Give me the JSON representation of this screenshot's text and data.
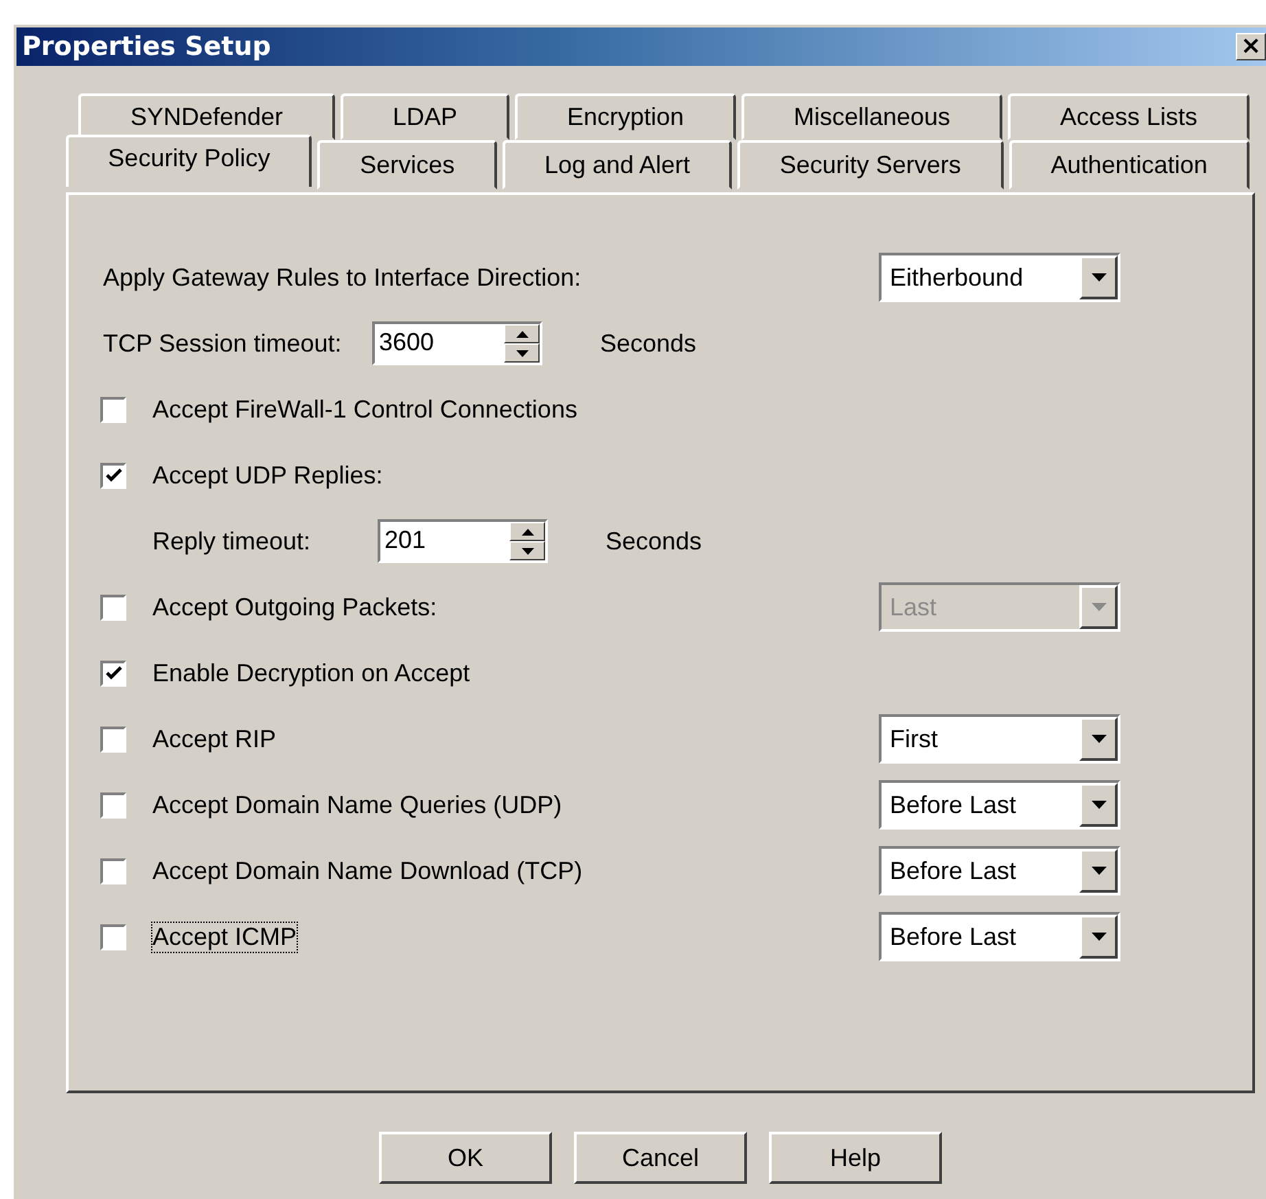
{
  "window": {
    "title": "Properties Setup",
    "close": "×"
  },
  "tab_rows": [
    [
      {
        "label": "SYNDefender",
        "selected": false
      },
      {
        "label": "LDAP",
        "selected": false
      },
      {
        "label": "Encryption",
        "selected": false
      },
      {
        "label": "Miscellaneous",
        "selected": false
      },
      {
        "label": "Access Lists",
        "selected": false
      }
    ],
    [
      {
        "label": "Security Policy",
        "selected": true
      },
      {
        "label": "Services",
        "selected": false
      },
      {
        "label": "Log and Alert",
        "selected": false
      },
      {
        "label": "Security Servers",
        "selected": false
      },
      {
        "label": "Authentication",
        "selected": false
      }
    ]
  ],
  "rows": [
    {
      "kind": "label_select",
      "label": "Apply Gateway Rules to Interface Direction:",
      "select": {
        "value": "Eitherbound",
        "disabled": false
      }
    },
    {
      "kind": "spin",
      "indent": false,
      "label": "TCP Session timeout:",
      "value": "3600",
      "unit": "Seconds"
    },
    {
      "kind": "check",
      "label": "Accept FireWall-1 Control Connections",
      "checked": false,
      "focused": false
    },
    {
      "kind": "check",
      "label": "Accept UDP Replies:",
      "checked": true,
      "focused": false
    },
    {
      "kind": "spin",
      "indent": true,
      "label": "Reply timeout:",
      "value": "201",
      "unit": "Seconds"
    },
    {
      "kind": "check",
      "label": "Accept Outgoing Packets:",
      "checked": false,
      "focused": false,
      "select": {
        "value": "Last",
        "disabled": true
      }
    },
    {
      "kind": "check",
      "label": "Enable Decryption on Accept",
      "checked": true,
      "focused": false
    },
    {
      "kind": "check",
      "label": "Accept RIP",
      "checked": false,
      "focused": false,
      "select": {
        "value": "First",
        "disabled": false
      }
    },
    {
      "kind": "check",
      "label": "Accept Domain Name Queries (UDP)",
      "checked": false,
      "focused": false,
      "select": {
        "value": "Before Last",
        "disabled": false
      }
    },
    {
      "kind": "check",
      "label": "Accept Domain Name Download (TCP)",
      "checked": false,
      "focused": false,
      "select": {
        "value": "Before Last",
        "disabled": false
      }
    },
    {
      "kind": "check",
      "label": "Accept ICMP",
      "checked": false,
      "focused": true,
      "select": {
        "value": "Before Last",
        "disabled": false
      }
    }
  ],
  "buttons": [
    "OK",
    "Cancel",
    "Help"
  ]
}
